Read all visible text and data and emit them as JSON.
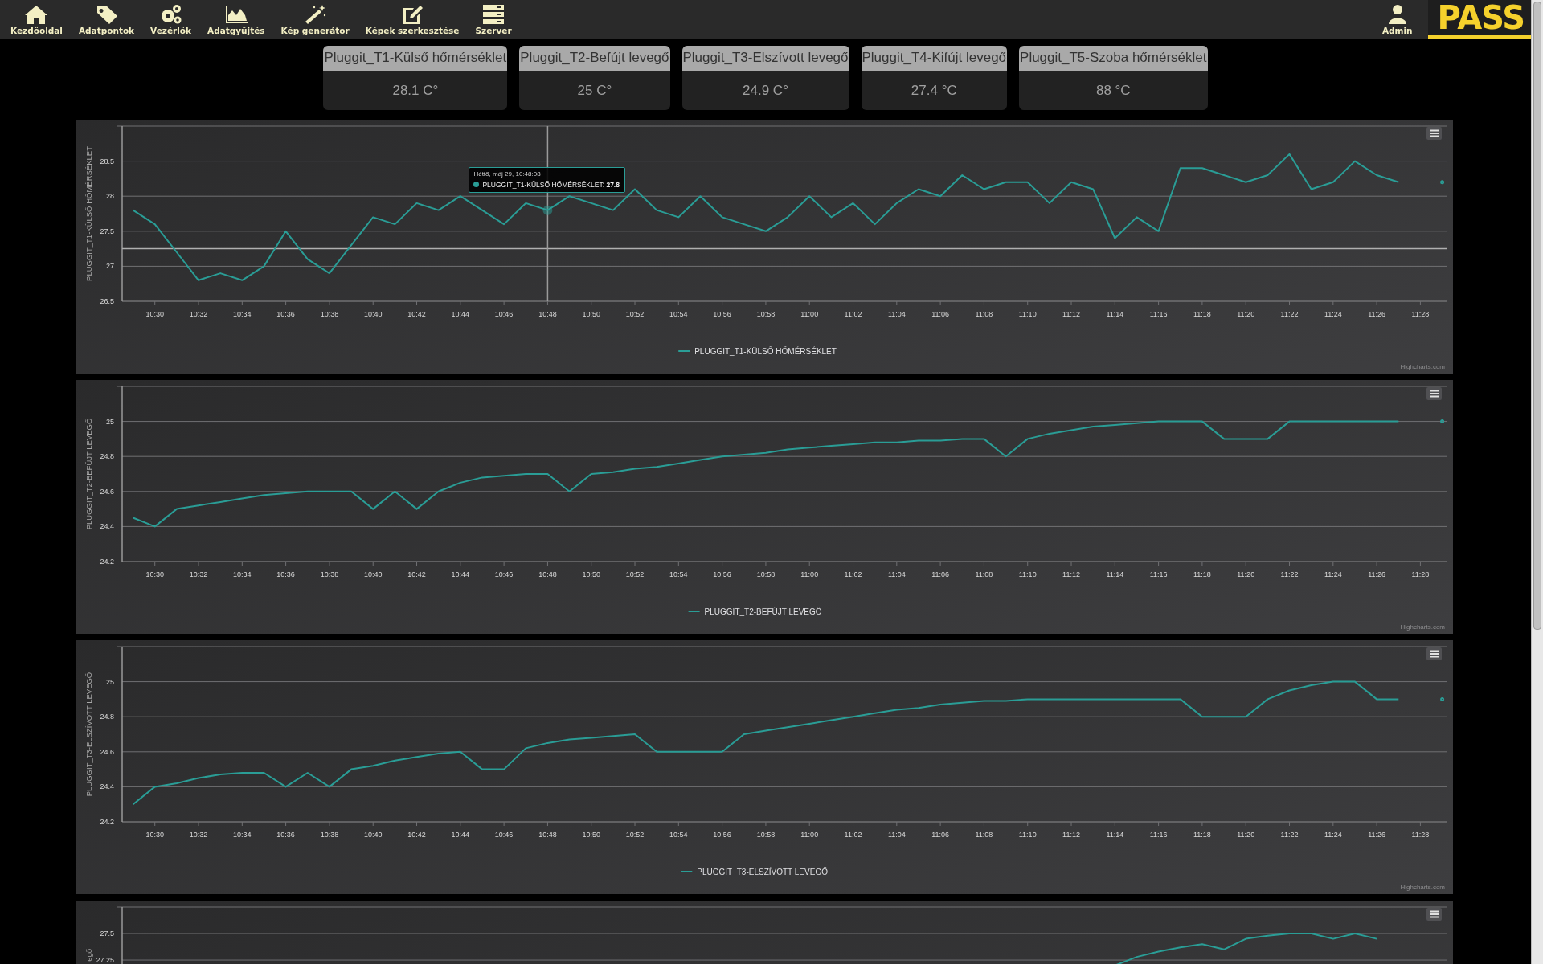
{
  "nav": {
    "items": [
      {
        "label": "Kezdőoldal",
        "kind": "home"
      },
      {
        "label": "Adatpontok",
        "kind": "tag"
      },
      {
        "label": "Vezérlők",
        "kind": "gears"
      },
      {
        "label": "Adatgyűjtés",
        "kind": "area"
      },
      {
        "label": "Kép generátor",
        "kind": "wand"
      },
      {
        "label": "Képek szerkesztése",
        "kind": "edit"
      },
      {
        "label": "Szerver",
        "kind": "server"
      }
    ],
    "user": {
      "label": "Admin"
    },
    "logo": "PASS"
  },
  "cards": [
    {
      "title": "Pluggit_T1-Külső hőmérséklet",
      "value": "28.1 C°"
    },
    {
      "title": "Pluggit_T2-Befújt levegő",
      "value": "25 C°"
    },
    {
      "title": "Pluggit_T3-Elszívott levegő",
      "value": "24.9 C°"
    },
    {
      "title": "Pluggit_T4-Kifújt levegő",
      "value": "27.4 °C"
    },
    {
      "title": "Pluggit_T5-Szoba hőmérséklet",
      "value": "88 °C"
    }
  ],
  "charts": [
    {
      "credits": "Highcharts.com",
      "cut": false,
      "tooltip": {
        "date": "Hétfő, máj 29, 10:48:08",
        "label": "PLUGGIT_T1-KÜLSŐ HŐMÉRSÉKLET: **27.8**"
      },
      "chart_data": {
        "type": "line",
        "ylabel": "PLUGGIT_T1-KÜLSŐ HŐMÉRSÉKLET",
        "ylim": [
          26.5,
          29
        ],
        "yticks": [
          26.5,
          27,
          27.5,
          28,
          28.5
        ],
        "ref_lines": [
          {
            "axis": "y",
            "value": 27.25
          }
        ],
        "grid": true,
        "categories": [
          null,
          "10:30",
          null,
          "10:32",
          null,
          "10:34",
          null,
          "10:36",
          null,
          "10:38",
          null,
          "10:40",
          null,
          "10:42",
          null,
          "10:44",
          null,
          "10:46",
          null,
          "10:48",
          null,
          "10:50",
          null,
          "10:52",
          null,
          "10:54",
          null,
          "10:56",
          null,
          "10:58",
          null,
          "11:00",
          null,
          "11:02",
          null,
          "11:04",
          null,
          "11:06",
          null,
          "11:08",
          null,
          "11:10",
          null,
          "11:12",
          null,
          "11:14",
          null,
          "11:16",
          null,
          "11:18",
          null,
          "11:20",
          null,
          "11:22",
          null,
          "11:24",
          null,
          "11:26",
          null,
          "11:28",
          null
        ],
        "series": [
          {
            "name": "PLUGGIT_T1-KÜLSŐ HŐMÉRSÉKLET",
            "color": "#2a9d96",
            "values": [
              27.8,
              27.6,
              27.2,
              26.8,
              26.9,
              26.8,
              27.0,
              27.5,
              27.1,
              26.9,
              27.3,
              27.7,
              27.6,
              27.9,
              27.8,
              28.0,
              27.8,
              27.6,
              27.9,
              27.8,
              28.0,
              27.9,
              27.8,
              28.1,
              27.8,
              27.7,
              28.0,
              27.7,
              27.6,
              27.5,
              27.7,
              28.0,
              27.7,
              27.9,
              27.6,
              27.9,
              28.1,
              28.0,
              28.3,
              28.1,
              28.2,
              28.2,
              27.9,
              28.2,
              28.1,
              27.4,
              27.7,
              27.5,
              28.4,
              28.4,
              28.3,
              28.2,
              28.3,
              28.6,
              28.1,
              28.2,
              28.5,
              28.3,
              28.2,
              null,
              28.2
            ]
          }
        ]
      }
    },
    {
      "credits": "Highcharts.com",
      "cut": false,
      "chart_data": {
        "type": "line",
        "ylabel": "PLUGGIT_T2-BEFÚJT LEVEGŐ",
        "grid": true,
        "ylim": [
          24.2,
          25.2
        ],
        "yticks": [
          24.2,
          24.4,
          24.6,
          24.8,
          25
        ],
        "categories": [
          null,
          "10:30",
          null,
          "10:32",
          null,
          "10:34",
          null,
          "10:36",
          null,
          "10:38",
          null,
          "10:40",
          null,
          "10:42",
          null,
          "10:44",
          null,
          "10:46",
          null,
          "10:48",
          null,
          "10:50",
          null,
          "10:52",
          null,
          "10:54",
          null,
          "10:56",
          null,
          "10:58",
          null,
          "11:00",
          null,
          "11:02",
          null,
          "11:04",
          null,
          "11:06",
          null,
          "11:08",
          null,
          "11:10",
          null,
          "11:12",
          null,
          "11:14",
          null,
          "11:16",
          null,
          "11:18",
          null,
          "11:20",
          null,
          "11:22",
          null,
          "11:24",
          null,
          "11:26",
          null,
          "11:28",
          null
        ],
        "series": [
          {
            "name": "PLUGGIT_T2-BEFÚJT LEVEGŐ",
            "color": "#2a9d96",
            "values": [
              24.45,
              24.4,
              24.5,
              24.52,
              24.54,
              24.56,
              24.58,
              24.59,
              24.6,
              24.6,
              24.6,
              24.5,
              24.6,
              24.5,
              24.6,
              24.65,
              24.68,
              24.69,
              24.7,
              24.7,
              24.6,
              24.7,
              24.71,
              24.73,
              24.74,
              24.76,
              24.78,
              24.8,
              24.81,
              24.82,
              24.84,
              24.85,
              24.86,
              24.87,
              24.88,
              24.88,
              24.89,
              24.89,
              24.9,
              24.9,
              24.8,
              24.9,
              24.93,
              24.95,
              24.97,
              24.98,
              24.99,
              25,
              25,
              25,
              24.9,
              24.9,
              24.9,
              25,
              25,
              25,
              25,
              25,
              25,
              null,
              25
            ]
          }
        ]
      }
    },
    {
      "credits": "Highcharts.com",
      "cut": false,
      "chart_data": {
        "type": "line",
        "ylabel": "PLUGGIT_T3-ELSZÍVOTT LEVEGŐ",
        "grid": true,
        "ylim": [
          24.2,
          25.2
        ],
        "yticks": [
          24.2,
          24.4,
          24.6,
          24.8,
          25
        ],
        "categories": [
          null,
          "10:30",
          null,
          "10:32",
          null,
          "10:34",
          null,
          "10:36",
          null,
          "10:38",
          null,
          "10:40",
          null,
          "10:42",
          null,
          "10:44",
          null,
          "10:46",
          null,
          "10:48",
          null,
          "10:50",
          null,
          "10:52",
          null,
          "10:54",
          null,
          "10:56",
          null,
          "10:58",
          null,
          "11:00",
          null,
          "11:02",
          null,
          "11:04",
          null,
          "11:06",
          null,
          "11:08",
          null,
          "11:10",
          null,
          "11:12",
          null,
          "11:14",
          null,
          "11:16",
          null,
          "11:18",
          null,
          "11:20",
          null,
          "11:22",
          null,
          "11:24",
          null,
          "11:26",
          null,
          "11:28",
          null
        ],
        "series": [
          {
            "name": "PLUGGIT_T3-ELSZÍVOTT LEVEGŐ",
            "color": "#2a9d96",
            "values": [
              24.3,
              24.4,
              24.42,
              24.45,
              24.47,
              24.48,
              24.48,
              24.4,
              24.48,
              24.4,
              24.5,
              24.52,
              24.55,
              24.57,
              24.59,
              24.6,
              24.5,
              24.5,
              24.62,
              24.65,
              24.67,
              24.68,
              24.69,
              24.7,
              24.6,
              24.6,
              24.6,
              24.6,
              24.7,
              24.72,
              24.74,
              24.76,
              24.78,
              24.8,
              24.82,
              24.84,
              24.85,
              24.87,
              24.88,
              24.89,
              24.89,
              24.9,
              24.9,
              24.9,
              24.9,
              24.9,
              24.9,
              24.9,
              24.9,
              24.8,
              24.8,
              24.8,
              24.9,
              24.95,
              24.98,
              25,
              25,
              24.9,
              24.9,
              null,
              24.9
            ]
          }
        ]
      }
    },
    {
      "cut": true,
      "chart_data": {
        "type": "line",
        "ylabel": "egő",
        "grid": true,
        "categories": [
          null,
          null,
          null,
          null,
          null,
          null,
          null,
          null,
          null,
          null,
          null,
          null,
          null,
          null,
          null,
          null,
          null,
          null,
          null,
          null,
          null,
          null,
          null,
          null,
          null,
          null,
          null,
          null,
          null,
          null,
          null,
          null,
          null,
          null,
          null,
          null,
          null,
          null,
          null,
          null,
          null,
          null,
          null,
          null,
          null,
          null,
          null,
          null,
          null,
          null,
          null,
          null,
          null,
          null,
          null,
          null,
          null,
          null,
          null,
          null,
          null
        ],
        "ylim": [
          26.1,
          27.75
        ],
        "yticks": [
          27.25,
          27.5
        ],
        "series": [
          {
            "color": "#2a9d96",
            "values": [
              null,
              null,
              null,
              null,
              null,
              null,
              null,
              null,
              null,
              null,
              null,
              null,
              null,
              null,
              null,
              null,
              null,
              null,
              null,
              null,
              null,
              null,
              null,
              null,
              null,
              null,
              null,
              null,
              null,
              null,
              null,
              null,
              null,
              null,
              null,
              null,
              null,
              null,
              null,
              null,
              null,
              null,
              null,
              null,
              null,
              27.2,
              27.28,
              27.33,
              27.37,
              27.4,
              27.35,
              27.45,
              27.48,
              27.5,
              27.5,
              27.45,
              27.5,
              27.45,
              null,
              null,
              null
            ]
          }
        ]
      }
    }
  ]
}
